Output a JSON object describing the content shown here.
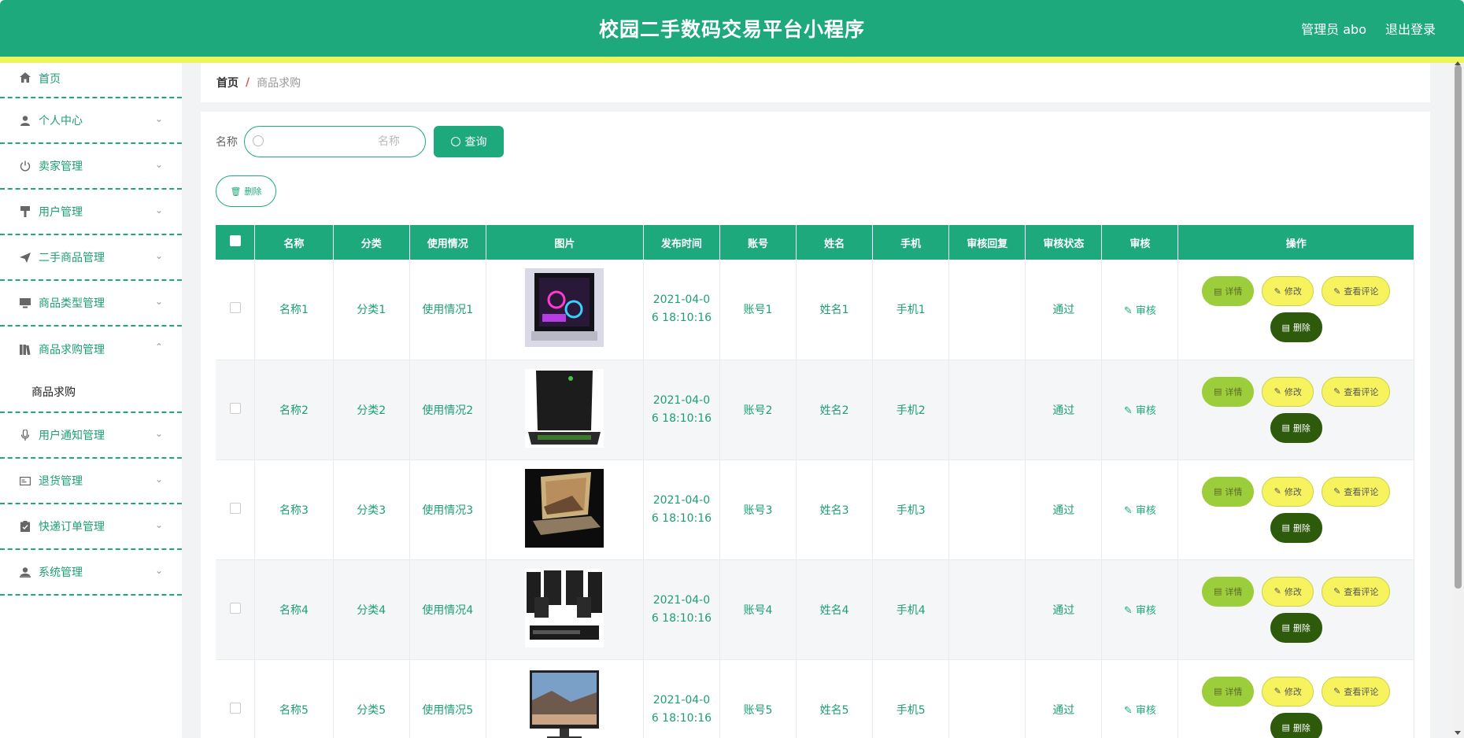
{
  "header": {
    "title": "校园二手数码交易平台小程序",
    "user": "管理员 abo",
    "logout": "退出登录"
  },
  "sidebar": {
    "items": [
      {
        "label": "首页",
        "icon": "home-icon"
      },
      {
        "label": "个人中心",
        "icon": "user-icon"
      },
      {
        "label": "卖家管理",
        "icon": "power-icon"
      },
      {
        "label": "用户管理",
        "icon": "brush-icon"
      },
      {
        "label": "二手商品管理",
        "icon": "send-icon"
      },
      {
        "label": "商品类型管理",
        "icon": "monitor-icon"
      },
      {
        "label": "商品求购管理",
        "icon": "books-icon"
      },
      {
        "label": "用户通知管理",
        "icon": "microphone-icon"
      },
      {
        "label": "退货管理",
        "icon": "card-icon"
      },
      {
        "label": "快递订单管理",
        "icon": "clipboard-icon"
      },
      {
        "label": "系统管理",
        "icon": "person-icon"
      }
    ],
    "submenu": "商品求购"
  },
  "breadcrumb": {
    "home": "首页",
    "sep": "/",
    "current": "商品求购"
  },
  "search": {
    "label": "名称",
    "placeholder": "名称",
    "button": "查询"
  },
  "toolbar": {
    "delete": "删除"
  },
  "table": {
    "headers": [
      "名称",
      "分类",
      "使用情况",
      "图片",
      "发布时间",
      "账号",
      "姓名",
      "手机",
      "审核回复",
      "审核状态",
      "审核",
      "操作"
    ],
    "rows": [
      {
        "name": "名称1",
        "category": "分类1",
        "usage": "使用情况1",
        "date1": "2021-04-0",
        "date2": "6 18:10:16",
        "account": "账号1",
        "realname": "姓名1",
        "phone": "手机1",
        "reply": "",
        "status": "通过",
        "audit": "审核",
        "image": "gaming-pc"
      },
      {
        "name": "名称2",
        "category": "分类2",
        "usage": "使用情况2",
        "date1": "2021-04-0",
        "date2": "6 18:10:16",
        "account": "账号2",
        "realname": "姓名2",
        "phone": "手机2",
        "reply": "",
        "status": "通过",
        "audit": "审核",
        "image": "laptop-black"
      },
      {
        "name": "名称3",
        "category": "分类3",
        "usage": "使用情况3",
        "date1": "2021-04-0",
        "date2": "6 18:10:16",
        "account": "账号3",
        "realname": "姓名3",
        "phone": "手机3",
        "reply": "",
        "status": "通过",
        "audit": "审核",
        "image": "laptop-gold"
      },
      {
        "name": "名称4",
        "category": "分类4",
        "usage": "使用情况4",
        "date1": "2021-04-0",
        "date2": "6 18:10:16",
        "account": "账号4",
        "realname": "姓名4",
        "phone": "手机4",
        "reply": "",
        "status": "通过",
        "audit": "审核",
        "image": "speakers"
      },
      {
        "name": "名称5",
        "category": "分类5",
        "usage": "使用情况5",
        "date1": "2021-04-0",
        "date2": "6 18:10:16",
        "account": "账号5",
        "realname": "姓名5",
        "phone": "手机5",
        "reply": "",
        "status": "通过",
        "audit": "审核",
        "image": "monitor"
      }
    ],
    "actions": {
      "detail": "详情",
      "edit": "修改",
      "comments": "查看评论",
      "delete": "删除"
    }
  },
  "colors": {
    "primary": "#1ea97c",
    "accent_stripe": "#ecf55a",
    "detail_btn": "#9ccd3a",
    "edit_btn": "#f6f35e",
    "delete_btn": "#2d5a0b"
  }
}
